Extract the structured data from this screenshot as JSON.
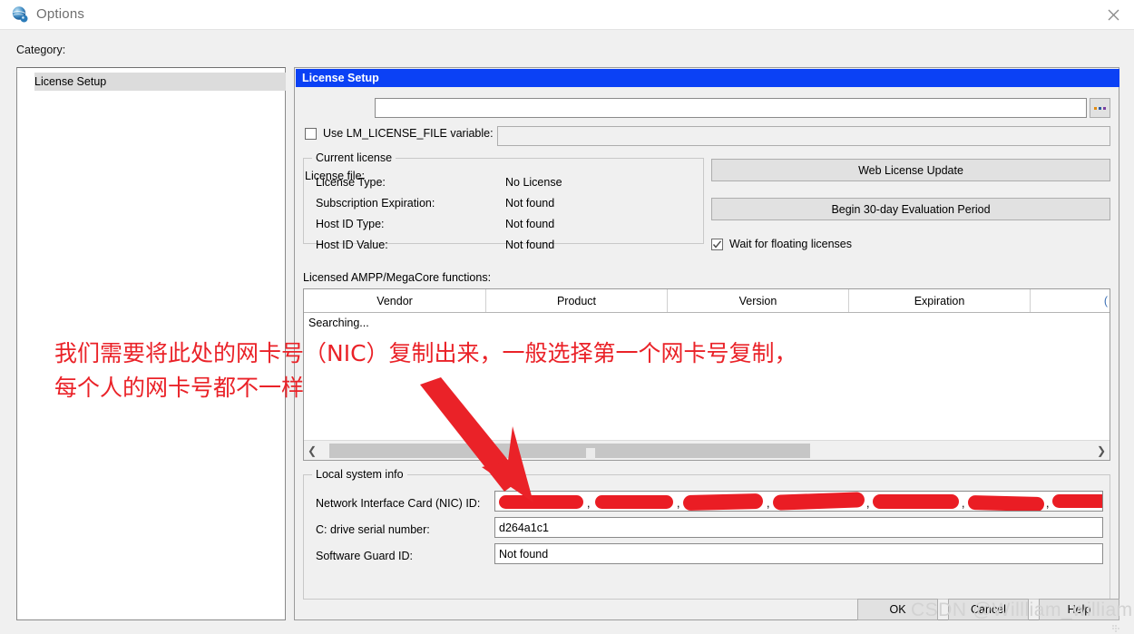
{
  "window": {
    "title": "Options",
    "icon": "quartus-globe-icon",
    "close_label": "close-icon"
  },
  "category_pane": {
    "label": "Category:",
    "items": [
      {
        "label": "License Setup",
        "selected": true
      }
    ]
  },
  "panel": {
    "header": "License Setup",
    "license_file": {
      "label": "License file:",
      "value": "",
      "placeholder": "",
      "browse_label": "..."
    },
    "lm_license": {
      "checkbox_label": "Use LM_LICENSE_FILE variable:",
      "checked": false,
      "value": ""
    },
    "current_license": {
      "title": "Current license",
      "rows": [
        {
          "label": "License Type:",
          "value": "No License"
        },
        {
          "label": "Subscription Expiration:",
          "value": "Not found"
        },
        {
          "label": "Host ID Type:",
          "value": "Not found"
        },
        {
          "label": "Host ID Value:",
          "value": "Not found"
        }
      ]
    },
    "actions": {
      "web_license_update": "Web License Update",
      "begin_evaluation": "Begin 30-day Evaluation Period",
      "wait_floating": {
        "label": "Wait for floating licenses",
        "checked": true
      }
    },
    "functions_table": {
      "label": "Licensed AMPP/MegaCore functions:",
      "columns": [
        "Vendor",
        "Product",
        "Version",
        "Expiration",
        "("
      ],
      "rows": [],
      "status_text": "Searching...",
      "scroll_left_icon": "chevron-left-icon",
      "scroll_right_icon": "chevron-right-icon"
    },
    "local_system_info": {
      "title": "Local system info",
      "rows": [
        {
          "label": "Network Interface Card (NIC) ID:",
          "value": "",
          "redacted": true,
          "blob_count": 7
        },
        {
          "label": "C: drive serial number:",
          "value": "d264a1c1",
          "redacted": false
        },
        {
          "label": "Software Guard ID:",
          "value": "Not found",
          "redacted": false
        }
      ]
    }
  },
  "footer": {
    "buttons": [
      "OK",
      "Cancel",
      "Help"
    ]
  },
  "annotation": {
    "color": "#ea2228",
    "line1": "我们需要将此处的网卡号（NIC）复制出来，一般选择第一个网卡号复制，",
    "line2": "每个人的网卡号都不一样",
    "arrow": "red-arrow-pointing-to-nic-field"
  },
  "watermark": {
    "text": "CSDN @Willliam_william"
  }
}
